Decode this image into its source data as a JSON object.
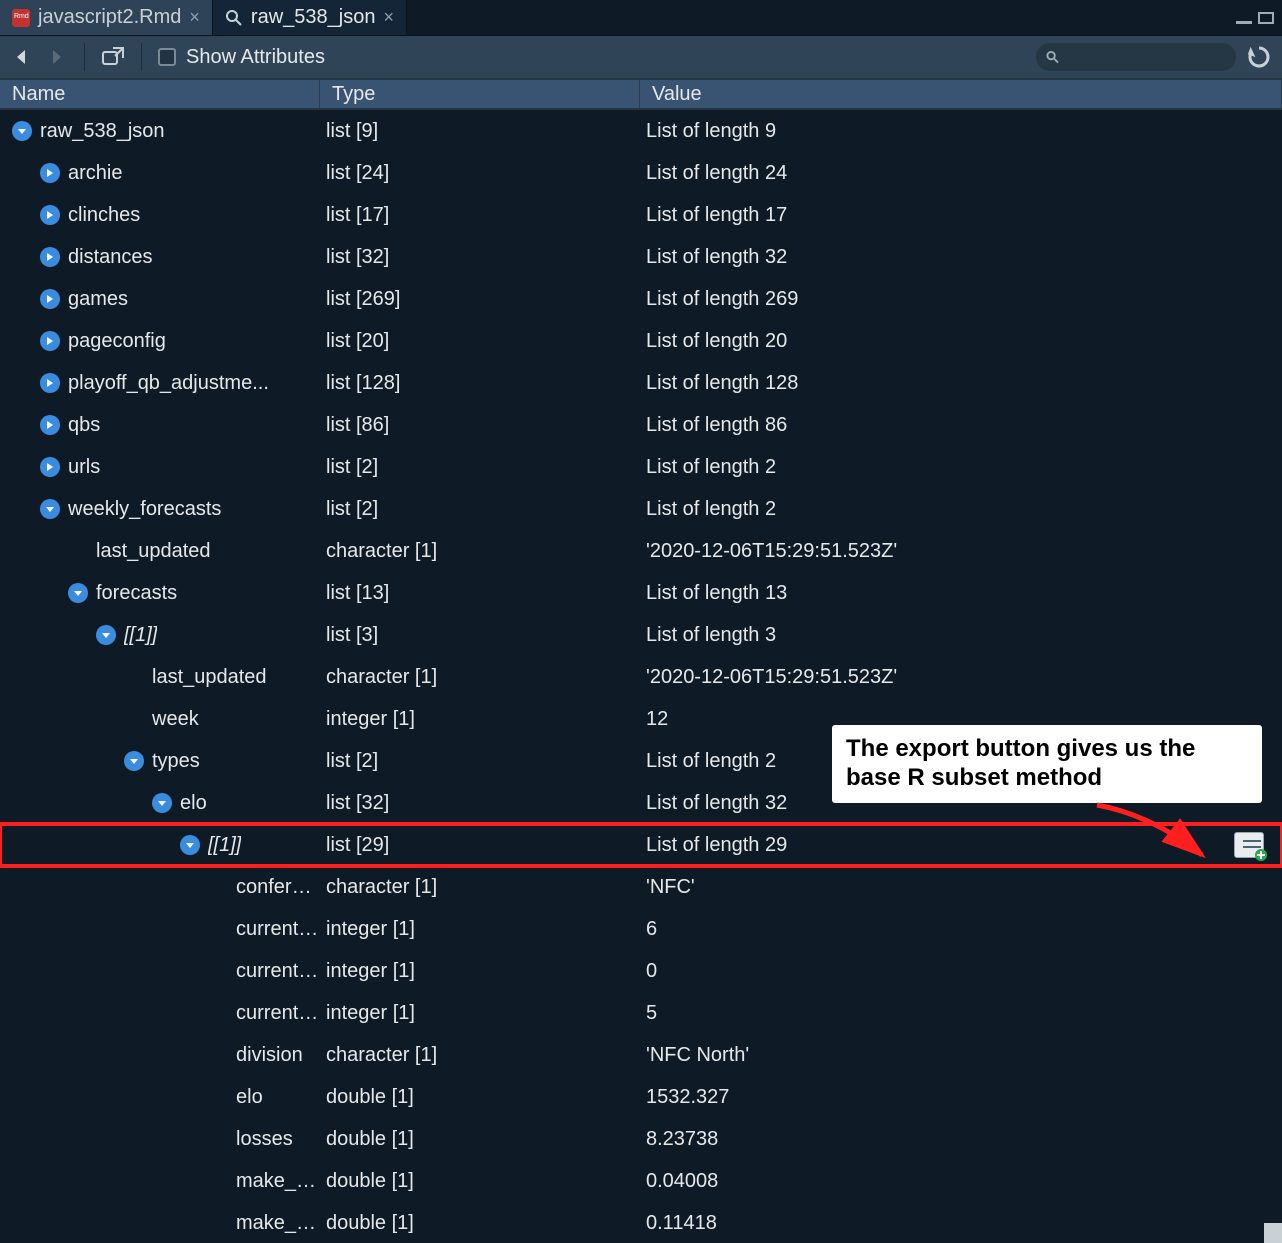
{
  "tabs": [
    {
      "label": "javascript2.Rmd",
      "active": false,
      "icon": "rmd"
    },
    {
      "label": "raw_538_json",
      "active": true,
      "icon": "search"
    }
  ],
  "toolbar": {
    "show_attributes_label": "Show Attributes",
    "search_placeholder": ""
  },
  "columns": {
    "name": "Name",
    "type": "Type",
    "value": "Value"
  },
  "annotation": {
    "text": "The export button gives us the base R subset method"
  },
  "rows": [
    {
      "indent": 0,
      "expander": "expanded",
      "italic": false,
      "name": "raw_538_json",
      "type": "list [9]",
      "value": "List of length 9"
    },
    {
      "indent": 1,
      "expander": "collapsed",
      "italic": false,
      "name": "archie",
      "type": "list [24]",
      "value": "List of length 24"
    },
    {
      "indent": 1,
      "expander": "collapsed",
      "italic": false,
      "name": "clinches",
      "type": "list [17]",
      "value": "List of length 17"
    },
    {
      "indent": 1,
      "expander": "collapsed",
      "italic": false,
      "name": "distances",
      "type": "list [32]",
      "value": "List of length 32"
    },
    {
      "indent": 1,
      "expander": "collapsed",
      "italic": false,
      "name": "games",
      "type": "list [269]",
      "value": "List of length 269"
    },
    {
      "indent": 1,
      "expander": "collapsed",
      "italic": false,
      "name": "pageconfig",
      "type": "list [20]",
      "value": "List of length 20"
    },
    {
      "indent": 1,
      "expander": "collapsed",
      "italic": false,
      "name": "playoff_qb_adjustme...",
      "type": "list [128]",
      "value": "List of length 128"
    },
    {
      "indent": 1,
      "expander": "collapsed",
      "italic": false,
      "name": "qbs",
      "type": "list [86]",
      "value": "List of length 86"
    },
    {
      "indent": 1,
      "expander": "collapsed",
      "italic": false,
      "name": "urls",
      "type": "list [2]",
      "value": "List of length 2"
    },
    {
      "indent": 1,
      "expander": "expanded",
      "italic": false,
      "name": "weekly_forecasts",
      "type": "list [2]",
      "value": "List of length 2"
    },
    {
      "indent": 2,
      "expander": "none",
      "italic": false,
      "name": "last_updated",
      "type": "character [1]",
      "value": "'2020-12-06T15:29:51.523Z'"
    },
    {
      "indent": 2,
      "expander": "expanded",
      "italic": false,
      "name": "forecasts",
      "type": "list [13]",
      "value": "List of length 13"
    },
    {
      "indent": 3,
      "expander": "expanded",
      "italic": true,
      "name": "[[1]]",
      "type": "list [3]",
      "value": "List of length 3"
    },
    {
      "indent": 4,
      "expander": "none",
      "italic": false,
      "name": "last_updated",
      "type": "character [1]",
      "value": "'2020-12-06T15:29:51.523Z'"
    },
    {
      "indent": 4,
      "expander": "none",
      "italic": false,
      "name": "week",
      "type": "integer [1]",
      "value": "12"
    },
    {
      "indent": 4,
      "expander": "expanded",
      "italic": false,
      "name": "types",
      "type": "list [2]",
      "value": "List of length 2"
    },
    {
      "indent": 5,
      "expander": "expanded",
      "italic": false,
      "name": "elo",
      "type": "list [32]",
      "value": "List of length 32"
    },
    {
      "indent": 6,
      "expander": "expanded",
      "italic": true,
      "name": "[[1]]",
      "type": "list [29]",
      "value": "List of length 29",
      "highlight": true,
      "export": true
    },
    {
      "indent": 7,
      "expander": "none",
      "italic": false,
      "name": "conference",
      "type": "character [1]",
      "value": "'NFC'"
    },
    {
      "indent": 7,
      "expander": "none",
      "italic": false,
      "name": "current_lo...",
      "type": "integer [1]",
      "value": "6"
    },
    {
      "indent": 7,
      "expander": "none",
      "italic": false,
      "name": "current_ties",
      "type": "integer [1]",
      "value": "0"
    },
    {
      "indent": 7,
      "expander": "none",
      "italic": false,
      "name": "current_wi...",
      "type": "integer [1]",
      "value": "5"
    },
    {
      "indent": 7,
      "expander": "none",
      "italic": false,
      "name": "division",
      "type": "character [1]",
      "value": "'NFC North'"
    },
    {
      "indent": 7,
      "expander": "none",
      "italic": false,
      "name": "elo",
      "type": "double [1]",
      "value": "1532.327"
    },
    {
      "indent": 7,
      "expander": "none",
      "italic": false,
      "name": "losses",
      "type": "double [1]",
      "value": "8.23738"
    },
    {
      "indent": 7,
      "expander": "none",
      "italic": false,
      "name": "make_con...",
      "type": "double [1]",
      "value": "0.04008"
    },
    {
      "indent": 7,
      "expander": "none",
      "italic": false,
      "name": "make_divi...",
      "type": "double [1]",
      "value": "0.11418"
    }
  ]
}
